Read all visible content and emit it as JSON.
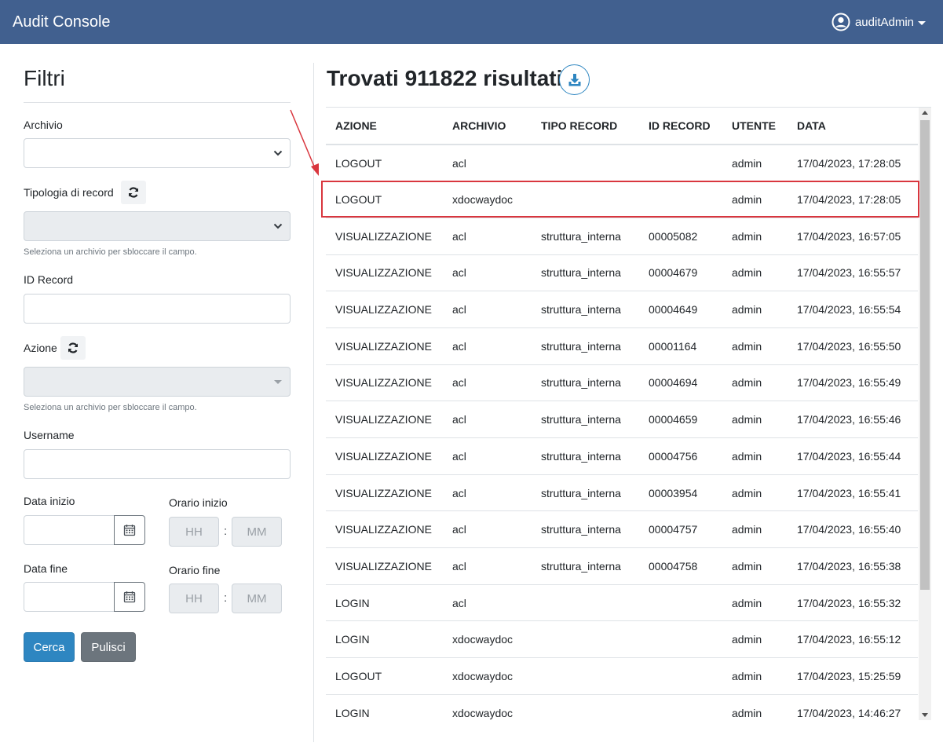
{
  "app": {
    "title": "Audit Console"
  },
  "user": {
    "name": "auditAdmin",
    "icon": "user-circle-icon"
  },
  "filters": {
    "title": "Filtri",
    "archivio_label": "Archivio",
    "archivio_value": "",
    "tipologia_label": "Tipologia di record",
    "tipologia_help": "Seleziona un archivio per sbloccare il campo.",
    "id_record_label": "ID Record",
    "id_record_value": "",
    "azione_label": "Azione",
    "azione_help": "Seleziona un archivio per sbloccare il campo.",
    "username_label": "Username",
    "username_value": "",
    "data_inizio_label": "Data inizio",
    "orario_inizio_label": "Orario inizio",
    "data_fine_label": "Data fine",
    "orario_fine_label": "Orario fine",
    "hh_placeholder": "HH",
    "mm_placeholder": "MM",
    "time_separator": ":",
    "search_label": "Cerca",
    "clear_label": "Pulisci"
  },
  "results": {
    "title": "Trovati 911822 risultati",
    "columns": [
      "AZIONE",
      "ARCHIVIO",
      "TIPO RECORD",
      "ID RECORD",
      "UTENTE",
      "DATA"
    ],
    "rows": [
      [
        "LOGOUT",
        "acl",
        "",
        "",
        "admin",
        "17/04/2023, 17:28:05"
      ],
      [
        "LOGOUT",
        "xdocwaydoc",
        "",
        "",
        "admin",
        "17/04/2023, 17:28:05"
      ],
      [
        "VISUALIZZAZIONE",
        "acl",
        "struttura_interna",
        "00005082",
        "admin",
        "17/04/2023, 16:57:05"
      ],
      [
        "VISUALIZZAZIONE",
        "acl",
        "struttura_interna",
        "00004679",
        "admin",
        "17/04/2023, 16:55:57"
      ],
      [
        "VISUALIZZAZIONE",
        "acl",
        "struttura_interna",
        "00004649",
        "admin",
        "17/04/2023, 16:55:54"
      ],
      [
        "VISUALIZZAZIONE",
        "acl",
        "struttura_interna",
        "00001164",
        "admin",
        "17/04/2023, 16:55:50"
      ],
      [
        "VISUALIZZAZIONE",
        "acl",
        "struttura_interna",
        "00004694",
        "admin",
        "17/04/2023, 16:55:49"
      ],
      [
        "VISUALIZZAZIONE",
        "acl",
        "struttura_interna",
        "00004659",
        "admin",
        "17/04/2023, 16:55:46"
      ],
      [
        "VISUALIZZAZIONE",
        "acl",
        "struttura_interna",
        "00004756",
        "admin",
        "17/04/2023, 16:55:44"
      ],
      [
        "VISUALIZZAZIONE",
        "acl",
        "struttura_interna",
        "00003954",
        "admin",
        "17/04/2023, 16:55:41"
      ],
      [
        "VISUALIZZAZIONE",
        "acl",
        "struttura_interna",
        "00004757",
        "admin",
        "17/04/2023, 16:55:40"
      ],
      [
        "VISUALIZZAZIONE",
        "acl",
        "struttura_interna",
        "00004758",
        "admin",
        "17/04/2023, 16:55:38"
      ],
      [
        "LOGIN",
        "acl",
        "",
        "",
        "admin",
        "17/04/2023, 16:55:32"
      ],
      [
        "LOGIN",
        "xdocwaydoc",
        "",
        "",
        "admin",
        "17/04/2023, 16:55:12"
      ],
      [
        "LOGOUT",
        "xdocwaydoc",
        "",
        "",
        "admin",
        "17/04/2023, 15:25:59"
      ],
      [
        "LOGIN",
        "xdocwaydoc",
        "",
        "",
        "admin",
        "17/04/2023, 14:46:27"
      ]
    ]
  },
  "colors": {
    "navbar": "#41608f",
    "primary": "#2e86c1",
    "secondary": "#6c757d",
    "highlight": "#d9363e"
  }
}
